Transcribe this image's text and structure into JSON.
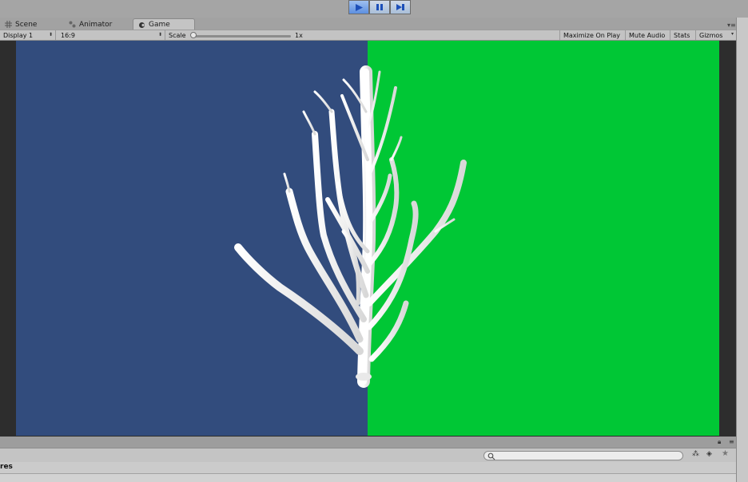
{
  "play_controls": {
    "play_icon": "play-icon",
    "pause_icon": "pause-icon",
    "step_icon": "step-icon"
  },
  "tabs": [
    {
      "label": "Scene",
      "icon": "grid-icon"
    },
    {
      "label": "Animator",
      "icon": "animator-icon"
    },
    {
      "label": "Game",
      "icon": "game-icon",
      "active": true
    }
  ],
  "toolbar": {
    "display": "Display 1",
    "aspect": "16:9",
    "scale_label": "Scale",
    "scale_value": "1x",
    "maximize_on_play": "Maximize On Play",
    "mute_audio": "Mute Audio",
    "stats": "Stats",
    "gizmos": "Gizmos"
  },
  "game_view": {
    "left_color": "#324c7d",
    "right_color": "#00c735",
    "object": "white-tree"
  },
  "bottom": {
    "label": "res"
  }
}
